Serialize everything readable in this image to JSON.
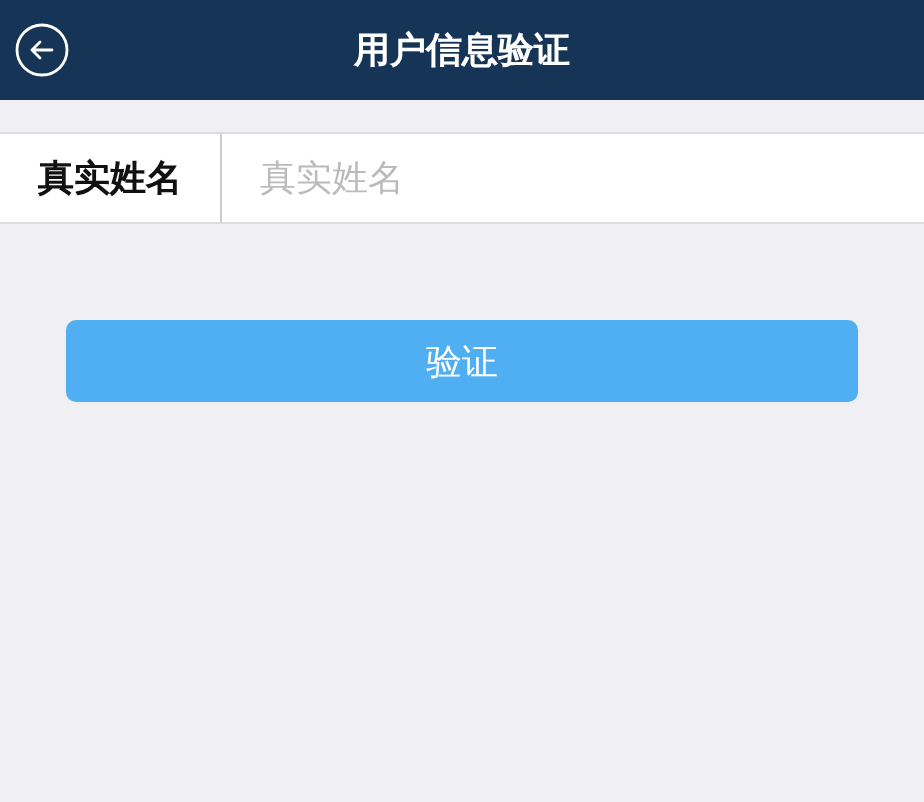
{
  "header": {
    "title": "用户信息验证"
  },
  "form": {
    "label": "真实姓名",
    "placeholder": "真实姓名"
  },
  "buttons": [
    "验证"
  ]
}
